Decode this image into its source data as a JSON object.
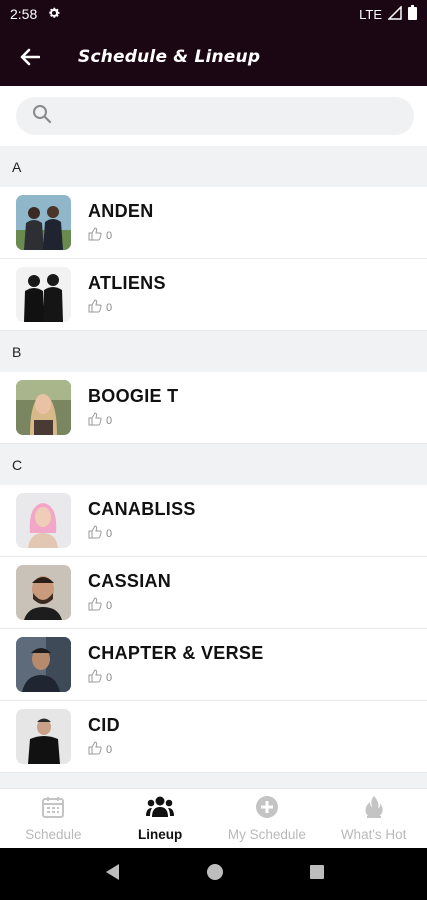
{
  "status": {
    "time": "2:58",
    "network": "LTE"
  },
  "appbar": {
    "title": "Schedule & Lineup"
  },
  "search": {
    "placeholder": ""
  },
  "sections": [
    {
      "letter": "A",
      "artists": [
        {
          "name": "ANDEN",
          "likes": "0"
        },
        {
          "name": "ATLIENS",
          "likes": "0"
        }
      ]
    },
    {
      "letter": "B",
      "artists": [
        {
          "name": "BOOGIE T",
          "likes": "0"
        }
      ]
    },
    {
      "letter": "C",
      "artists": [
        {
          "name": "CANABLISS",
          "likes": "0"
        },
        {
          "name": "CASSIAN",
          "likes": "0"
        },
        {
          "name": "CHAPTER & VERSE",
          "likes": "0"
        },
        {
          "name": "CID",
          "likes": "0"
        }
      ]
    }
  ],
  "tabs": [
    {
      "label": "Schedule",
      "icon": "calendar-icon",
      "active": false
    },
    {
      "label": "Lineup",
      "icon": "people-icon",
      "active": true
    },
    {
      "label": "My Schedule",
      "icon": "plus-circle-icon",
      "active": false
    },
    {
      "label": "What's Hot",
      "icon": "flame-icon",
      "active": false
    }
  ],
  "colors": {
    "appbar_bg": "#1b0714",
    "section_bg": "#f1f2f4",
    "active_tab": "#111111",
    "inactive_tab": "#b9b9b9"
  }
}
